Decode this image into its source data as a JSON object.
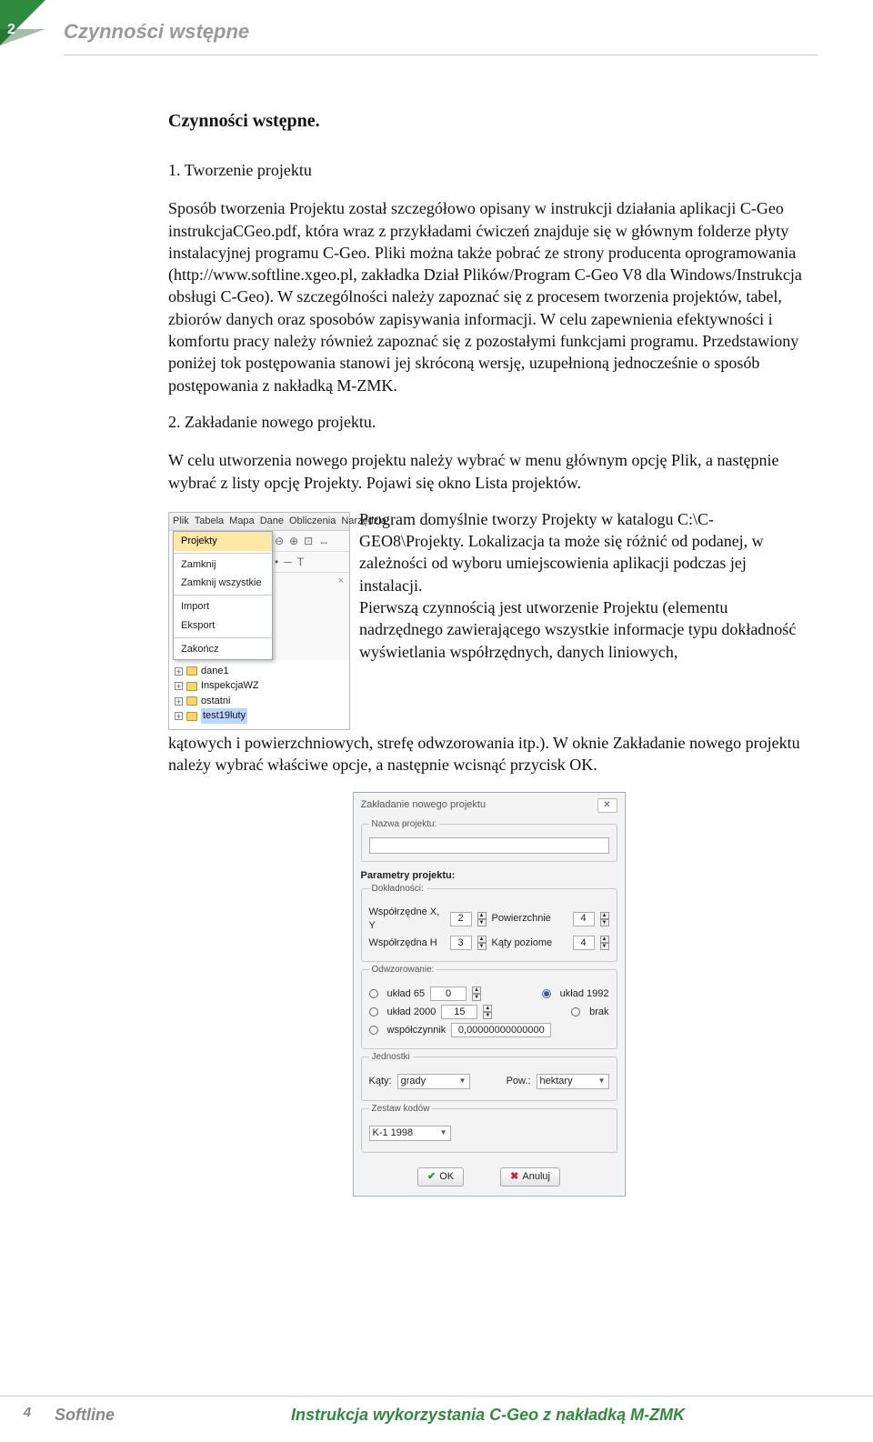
{
  "page": {
    "number_top": "2",
    "header": "Czynności wstępne",
    "title": "Czynności wstępne.",
    "section1_heading": "1. Tworzenie projektu",
    "para1": "Sposób tworzenia Projektu został szczegółowo opisany w instrukcji działania aplikacji C-Geo instrukcjaCGeo.pdf, która wraz z przykładami ćwiczeń znajduje się w głównym folderze płyty instalacyjnej programu C-Geo. Pliki można także pobrać ze strony producenta oprogramowania (http://www.softline.xgeo.pl, zakładka Dział Plików/Program C-Geo V8 dla Windows/Instrukcja obsługi C-Geo). W szczególności należy zapoznać się z procesem tworzenia projektów, tabel, zbiorów danych oraz sposobów zapisywania informacji. W celu zapewnienia efektywności i komfortu pracy należy również zapoznać się z pozostałymi funkcjami programu. Przedstawiony poniżej tok postępowania stanowi jej skróconą wersję, uzupełnioną jednocześnie o sposób postępowania z nakładką M-ZMK.",
    "section2_heading": "2. Zakładanie nowego projektu.",
    "para2": "W celu utworzenia nowego projektu należy wybrać w menu głównym opcję Plik, a następnie wybrać z listy opcję Projekty. Pojawi się okno Lista projektów.",
    "para3a": "Program domyślnie tworzy Projekty w katalogu C:\\C-GEO8\\Projekty. Lokalizacja ta może się różnić od podanej, w zależności od wyboru umiejscowienia aplikacji podczas jej instalacji.",
    "para3b": "Pierwszą czynnością jest utworzenie Projektu (elementu nadrzędnego zawierającego wszystkie informacje typu dokładność wyświetlania współrzędnych, danych liniowych,",
    "para3c": "kątowych i powierzchniowych, strefę odwzorowania itp.). W oknie Zakładanie nowego projektu należy wybrać właściwe opcje, a następnie wcisnąć przycisk OK."
  },
  "menubar": {
    "items": [
      "Plik",
      "Tabela",
      "Mapa",
      "Dane",
      "Obliczenia",
      "Narzędzia"
    ]
  },
  "dropdown": {
    "projekty": "Projekty",
    "zamknij": "Zamknij",
    "zamknij_wszystkie": "Zamknij wszystkie",
    "import": "Import",
    "eksport": "Eksport",
    "zakoncz": "Zakończ"
  },
  "tree": {
    "items": [
      "dane1",
      "InspekcjaWZ",
      "ostatni",
      "test19luty"
    ]
  },
  "dialog": {
    "title": "Zakładanie nowego projektu",
    "close": "✕",
    "grp_name": "Nazwa projektu:",
    "params_heading": "Parametry projektu:",
    "grp_dokl": "Dokładności:",
    "lbl_xy": "Współrzędne X, Y",
    "val_xy": "2",
    "lbl_pow": "Powierzchnie",
    "val_pow": "4",
    "lbl_h": "Współrzędna H",
    "val_h": "3",
    "lbl_katy": "Kąty poziome",
    "val_katy": "4",
    "grp_odwz": "Odwzorowanie:",
    "opt_65": "układ 65",
    "val_65": "0",
    "opt_1992": "układ 1992",
    "opt_2000": "układ 2000",
    "val_2000": "15",
    "opt_brak": "brak",
    "opt_wsp": "współczynnik",
    "val_wsp": "0,00000000000000",
    "grp_jedn": "Jednostki",
    "lbl_jkaty": "Kąty:",
    "val_jkaty": "grady",
    "lbl_jpow": "Pow.:",
    "val_jpow": "hektary",
    "grp_zestaw": "Zestaw kodów",
    "val_zestaw": "K-1 1998",
    "btn_ok": "OK",
    "btn_cancel": "Anuluj"
  },
  "footer": {
    "page_number": "4",
    "softline": "Softline",
    "doc": "Instrukcja wykorzystania C-Geo z nakładką M-ZMK"
  }
}
